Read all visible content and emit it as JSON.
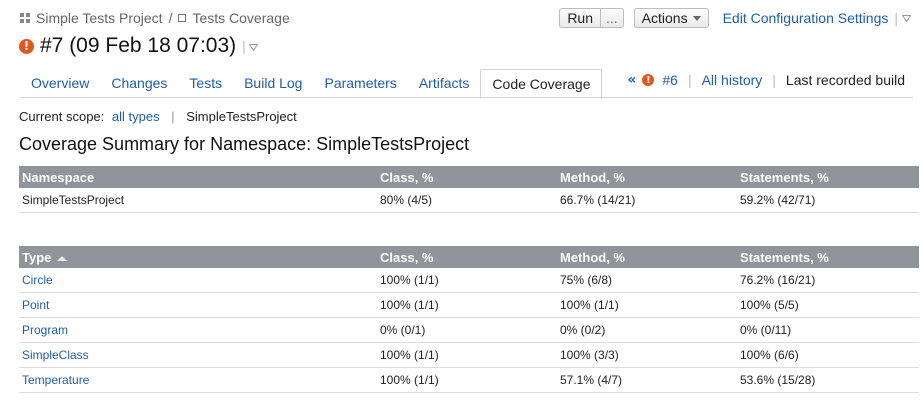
{
  "breadcrumb": {
    "project": "Simple Tests Project",
    "separator": "/",
    "config": "Tests Coverage"
  },
  "toolbar": {
    "run_label": "Run",
    "run_more_label": "...",
    "actions_label": "Actions",
    "edit_settings_label": "Edit Configuration Settings"
  },
  "build": {
    "title": "#7 (09 Feb 18 07:03)",
    "status_icon": "error-icon",
    "status_color": "#e2571e"
  },
  "tabs": [
    {
      "label": "Overview"
    },
    {
      "label": "Changes"
    },
    {
      "label": "Tests"
    },
    {
      "label": "Build Log"
    },
    {
      "label": "Parameters"
    },
    {
      "label": "Artifacts"
    },
    {
      "label": "Code Coverage",
      "active": true
    }
  ],
  "history": {
    "prev_icon": "double-chevron-left-icon",
    "prev_build": "#6",
    "all_history": "All history",
    "last_recorded": "Last recorded build"
  },
  "scope": {
    "label": "Current scope:",
    "link": "all types",
    "separator": "|",
    "current": "SimpleTestsProject"
  },
  "summary_heading": "Coverage Summary for Namespace: SimpleTestsProject",
  "namespace_table": {
    "headers": [
      "Namespace",
      "Class, %",
      "Method, %",
      "Statements, %"
    ],
    "rows": [
      [
        "SimpleTestsProject",
        "80% (4/5)",
        "66.7% (14/21)",
        "59.2% (42/71)"
      ]
    ]
  },
  "type_table": {
    "headers": [
      "Type",
      "Class, %",
      "Method, %",
      "Statements, %"
    ],
    "sort_icon": "sort-ascending-icon",
    "rows": [
      [
        "Circle",
        "100% (1/1)",
        "75% (6/8)",
        "76.2% (16/21)"
      ],
      [
        "Point",
        "100% (1/1)",
        "100% (1/1)",
        "100% (5/5)"
      ],
      [
        "Program",
        "0% (0/1)",
        "0% (0/2)",
        "0% (0/11)"
      ],
      [
        "SimpleClass",
        "100% (1/1)",
        "100% (3/3)",
        "100% (6/6)"
      ],
      [
        "Temperature",
        "100% (1/1)",
        "57.1% (4/7)",
        "53.6% (15/28)"
      ]
    ]
  },
  "colors": {
    "link": "#1f5ea8",
    "table_header_bg": "#8f959b",
    "error": "#e2571e"
  }
}
